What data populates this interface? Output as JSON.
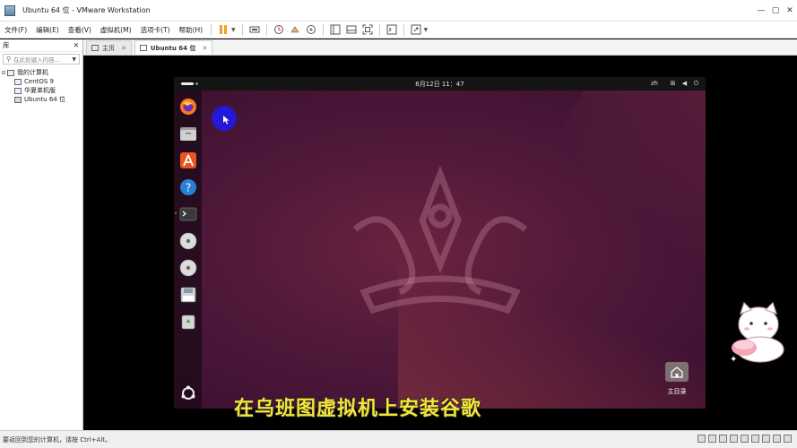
{
  "window": {
    "title": "Ubuntu 64 位 - VMware Workstation",
    "controls": [
      "—",
      "▢",
      "✕"
    ]
  },
  "menubar": {
    "items": [
      "文件(F)",
      "编辑(E)",
      "查看(V)",
      "虚拟机(M)",
      "选项卡(T)",
      "帮助(H)"
    ]
  },
  "library": {
    "title": "库",
    "close": "✕",
    "search_placeholder": "在此处键入内容...",
    "root": "我的计算机",
    "vms": [
      "CentOS 9",
      "华夏单机版",
      "Ubuntu 64 位"
    ]
  },
  "tabs": [
    {
      "label": "主页",
      "active": false,
      "close": "✕"
    },
    {
      "label": "Ubuntu 64 位",
      "active": true,
      "close": "✕"
    }
  ],
  "guest": {
    "clock": "6月12日  11：47",
    "language": "zh",
    "dock_apps": [
      "firefox-icon",
      "files-icon",
      "app-center-icon",
      "help-icon",
      "terminal-icon",
      "disc-icon",
      "disc-icon-2",
      "floppy-icon",
      "trash-icon",
      "show-apps-icon"
    ],
    "home_folder_label": "主目录"
  },
  "overlay": {
    "subtitle": "在乌班图虚拟机上安装谷歌"
  },
  "statusbar": {
    "text": "要返回到您的计算机，请按 Ctrl+Alt。"
  },
  "colors": {
    "accent": "#e95420",
    "subtitle": "#f5e63a",
    "cursor_highlight": "#2418d6",
    "wallpaper": "#51193a"
  }
}
